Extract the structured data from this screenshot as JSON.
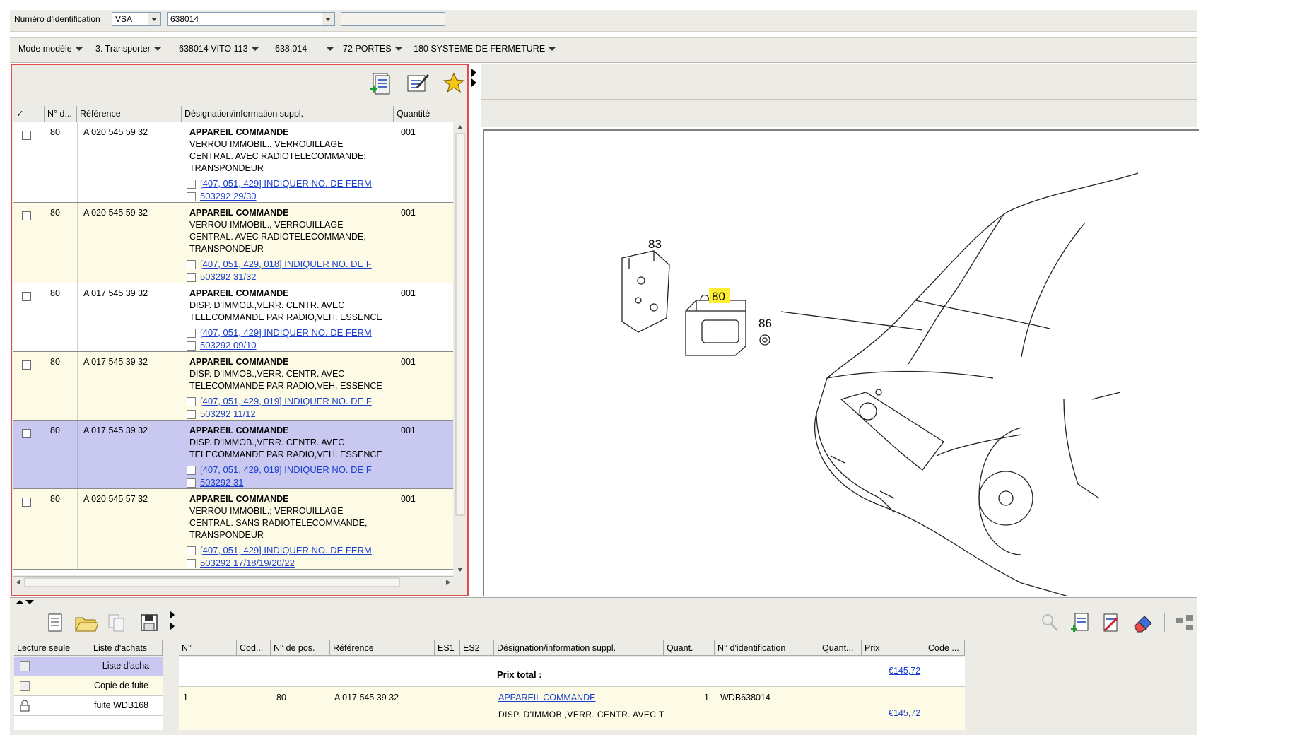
{
  "top": {
    "id_label": "Numéro d'identification",
    "id_type": "VSA",
    "id_value": "638014",
    "extra_field": ""
  },
  "model_bar": [
    {
      "label": "Mode modèle"
    },
    {
      "label": "3. Transporter"
    },
    {
      "label": "638014 VITO 113"
    },
    {
      "label": "638.014"
    },
    {
      "label": "72 PORTES"
    },
    {
      "label": "180 SYSTEME DE FERMETURE"
    }
  ],
  "parts_table": {
    "columns": [
      "✓",
      "N° d...",
      "Référence",
      "Désignation/information suppl.",
      "Quantité"
    ],
    "rows": [
      {
        "pos": "80",
        "ref": "A 020 545 59 32",
        "title": "APPAREIL COMMANDE",
        "lines": [
          "VERROU IMMOBIL., VERROUILLAGE",
          "CENTRAL. AVEC RADIOTELECOMMANDE;",
          "TRANSPONDEUR"
        ],
        "links": [
          "[407, 051, 429] INDIQUER NO. DE FERM",
          "503292 29/30"
        ],
        "qty": "001"
      },
      {
        "pos": "80",
        "ref": "A 020 545 59 32",
        "title": "APPAREIL COMMANDE",
        "lines": [
          "VERROU IMMOBIL., VERROUILLAGE",
          "CENTRAL. AVEC RADIOTELECOMMANDE;",
          "TRANSPONDEUR"
        ],
        "links": [
          "[407, 051, 429, 018] INDIQUER NO. DE F",
          "503292 31/32"
        ],
        "qty": "001"
      },
      {
        "pos": "80",
        "ref": "A 017 545 39 32",
        "title": "APPAREIL COMMANDE",
        "lines": [
          "DISP. D'IMMOB.,VERR. CENTR. AVEC",
          "TELECOMMANDE PAR RADIO,VEH. ESSENCE"
        ],
        "links": [
          "[407, 051, 429] INDIQUER NO. DE FERM",
          "503292 09/10"
        ],
        "qty": "001"
      },
      {
        "pos": "80",
        "ref": "A 017 545 39 32",
        "title": "APPAREIL COMMANDE",
        "lines": [
          "DISP. D'IMMOB.,VERR. CENTR. AVEC",
          "TELECOMMANDE PAR RADIO,VEH. ESSENCE"
        ],
        "links": [
          "[407, 051, 429, 019] INDIQUER NO. DE F",
          "503292 11/12"
        ],
        "qty": "001"
      },
      {
        "pos": "80",
        "ref": "A 017 545 39 32",
        "title": "APPAREIL COMMANDE",
        "lines": [
          "DISP. D'IMMOB.,VERR. CENTR. AVEC",
          "TELECOMMANDE PAR RADIO,VEH. ESSENCE"
        ],
        "links": [
          "[407, 051, 429, 019] INDIQUER NO. DE F",
          "503292 31"
        ],
        "qty": "001"
      },
      {
        "pos": "80",
        "ref": "A 020 545 57 32",
        "title": "APPAREIL COMMANDE",
        "lines": [
          "VERROU IMMOBIL.; VERROUILLAGE",
          "CENTRAL. SANS RADIOTELECOMMANDE,",
          "TRANSPONDEUR"
        ],
        "links": [
          "[407, 051, 429] INDIQUER NO. DE FERM",
          "503292 17/18/19/20/22"
        ],
        "qty": "001"
      }
    ]
  },
  "diagram": {
    "labels": [
      "83",
      "80",
      "86"
    ],
    "highlight_color": "#ffee33"
  },
  "lists": {
    "columns": [
      "Lecture seule",
      "Liste d'achats"
    ],
    "rows": [
      "-- Liste d'acha",
      "Copie de fuite",
      "fuite WDB168"
    ]
  },
  "basket": {
    "columns": [
      "N°",
      "Cod...",
      "N° de pos.",
      "Référence",
      "ES1",
      "ES2",
      "Désignation/information suppl.",
      "Quant.",
      "N° d'identification",
      "Quant...",
      "Prix",
      "Code ..."
    ],
    "total_label": "Prix total :",
    "total_price": "€145,72",
    "item": {
      "no": "1",
      "pos": "80",
      "ref": "A 017 545 39 32",
      "title": "APPAREIL COMMANDE",
      "desc": "DISP. D'IMMOB.,VERR. CENTR. AVEC T",
      "qty": "1",
      "vin": "WDB638014",
      "price": "€145,72"
    }
  },
  "colors": {
    "selected_row": "#c8c8f0",
    "alt_row": "#fdfbe6",
    "panel_border": "#e64b4b",
    "link": "#1a3ecf"
  }
}
